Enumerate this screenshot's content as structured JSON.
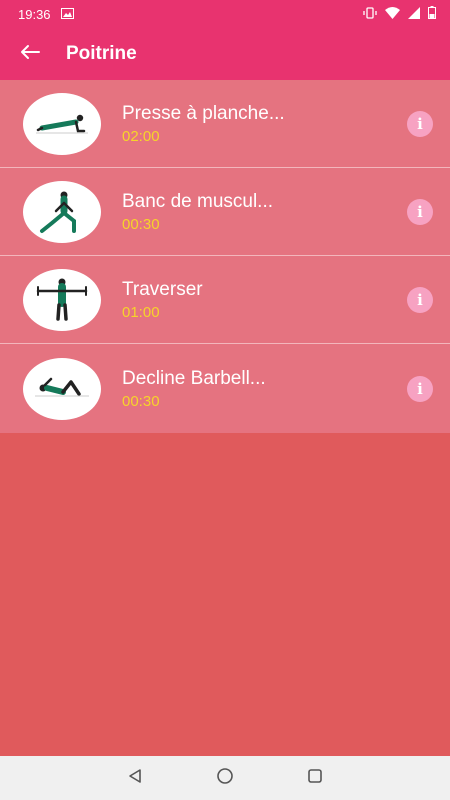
{
  "status_bar": {
    "time": "19:36"
  },
  "app_bar": {
    "title": "Poitrine"
  },
  "exercises": [
    {
      "name": "Presse à planche...",
      "duration": "02:00",
      "pose": "plank"
    },
    {
      "name": "Banc de muscul...",
      "duration": "00:30",
      "pose": "lunge-stretch"
    },
    {
      "name": "Traverser",
      "duration": "01:00",
      "pose": "arms-extended"
    },
    {
      "name": "Decline Barbell...",
      "duration": "00:30",
      "pose": "lying"
    }
  ],
  "info_glyph": "i",
  "colors": {
    "primary": "#e8336f",
    "row": "#e57380",
    "background": "#e05a5c",
    "duration": "#f6d42a",
    "info": "#f7a2c2"
  }
}
